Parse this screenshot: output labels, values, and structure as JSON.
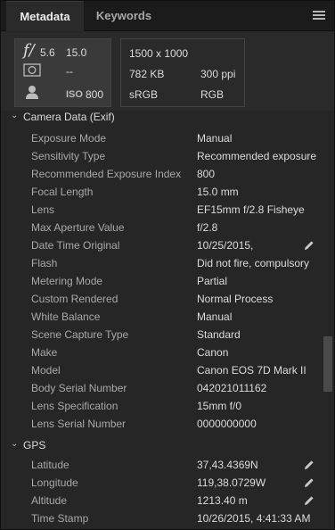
{
  "tabs": {
    "metadata": "Metadata",
    "keywords": "Keywords"
  },
  "summary": {
    "aperture_f": "f/",
    "aperture": "5.6",
    "focal_length": "15.0",
    "metering": "--",
    "iso_label": "ISO",
    "iso": "800",
    "dimensions": "1500 x 1000",
    "file_size": "782 KB",
    "resolution": "300 ppi",
    "color_profile": "sRGB",
    "color_mode": "RGB"
  },
  "sections": {
    "camera": "Camera Data (Exif)",
    "gps": "GPS"
  },
  "camera_rows": [
    {
      "label": "Exposure Mode",
      "value": "Manual"
    },
    {
      "label": "Sensitivity Type",
      "value": "Recommended exposure"
    },
    {
      "label": "Recommended Exposure Index",
      "value": "800"
    },
    {
      "label": "Focal Length",
      "value": "15.0 mm"
    },
    {
      "label": "Lens",
      "value": "EF15mm f/2.8 Fisheye"
    },
    {
      "label": "Max Aperture Value",
      "value": "f/2.8"
    },
    {
      "label": "Date Time Original",
      "value": "10/25/2015,"
    },
    {
      "label": "Flash",
      "value": "Did not fire, compulsory"
    },
    {
      "label": "Metering Mode",
      "value": "Partial"
    },
    {
      "label": "Custom Rendered",
      "value": "Normal Process"
    },
    {
      "label": "White Balance",
      "value": "Manual"
    },
    {
      "label": "Scene Capture Type",
      "value": "Standard"
    },
    {
      "label": "Make",
      "value": "Canon"
    },
    {
      "label": "Model",
      "value": "Canon EOS 7D Mark II"
    },
    {
      "label": "Body Serial Number",
      "value": "042021011162"
    },
    {
      "label": "Lens Specification",
      "value": "15mm f/0"
    },
    {
      "label": "Lens Serial Number",
      "value": "0000000000"
    }
  ],
  "gps_rows": [
    {
      "label": "Latitude",
      "value": "37,43.4369N"
    },
    {
      "label": "Longitude",
      "value": "119,38.0729W"
    },
    {
      "label": "Altitude",
      "value": "1213.40 m"
    },
    {
      "label": "Time Stamp",
      "value": "10/26/2015, 4:41:33 AM"
    }
  ],
  "colors": {
    "panel": "#262626",
    "tabbar": "#1b1b1b",
    "label": "#a9a9a9",
    "value": "#dcdcdc"
  },
  "icons": [
    "menu-icon",
    "aperture-icon",
    "metering-icon",
    "person-icon",
    "chevron-down-icon",
    "pencil-icon"
  ]
}
